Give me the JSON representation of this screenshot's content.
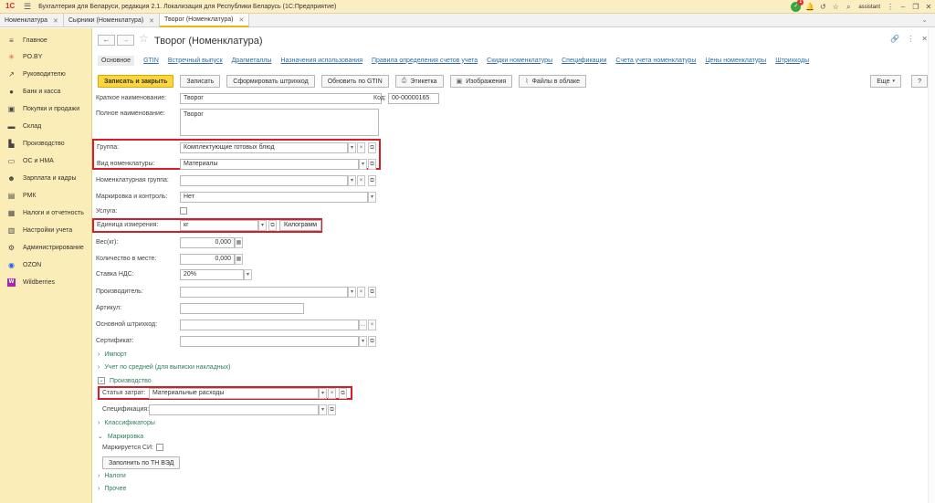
{
  "titlebar": {
    "logo": "1С",
    "title": "Бухгалтерия для Беларуси, редакция 2.1. Локализация для Республики Беларусь   (1С:Предприятие)",
    "notifications": "1",
    "user": "assistant"
  },
  "tabs": [
    {
      "label": "Номенклатура"
    },
    {
      "label": "Сырники (Номенклатура)"
    },
    {
      "label": "Творог (Номенклатура)"
    }
  ],
  "sidebar": {
    "items": [
      {
        "label": "Главное",
        "icon": "≡"
      },
      {
        "label": "PO.BY",
        "icon": "✳"
      },
      {
        "label": "Руководителю",
        "icon": "↗"
      },
      {
        "label": "Банк и касса",
        "icon": "●"
      },
      {
        "label": "Покупки и продажи",
        "icon": "▣"
      },
      {
        "label": "Склад",
        "icon": "▬"
      },
      {
        "label": "Производство",
        "icon": "▙"
      },
      {
        "label": "ОС и НМА",
        "icon": "▭"
      },
      {
        "label": "Зарплата и кадры",
        "icon": "☻"
      },
      {
        "label": "РМК",
        "icon": "▤"
      },
      {
        "label": "Налоги и отчетность",
        "icon": "▦"
      },
      {
        "label": "Настройки учета",
        "icon": "▥"
      },
      {
        "label": "Администрирование",
        "icon": "⚙"
      },
      {
        "label": "OZON",
        "icon": "◉"
      },
      {
        "label": "Wildberries",
        "icon": "W"
      }
    ]
  },
  "header": {
    "title": "Творог (Номенклатура)"
  },
  "sections": [
    {
      "label": "Основное"
    },
    {
      "label": "GTIN"
    },
    {
      "label": "Встречный выпуск"
    },
    {
      "label": "Драгметаллы"
    },
    {
      "label": "Назначения использования"
    },
    {
      "label": "Правила определения счетов учета"
    },
    {
      "label": "Скидки номенклатуры"
    },
    {
      "label": "Спецификации"
    },
    {
      "label": "Счета учета номенклатуры"
    },
    {
      "label": "Цены номенклатуры"
    },
    {
      "label": "Штрихкоды"
    }
  ],
  "toolbar": {
    "save_close": "Записать и закрыть",
    "save": "Записать",
    "barcode": "Сформировать штрихкод",
    "gtin": "Обновить по GTIN",
    "label": "Этикетка",
    "images": "Изображения",
    "files": "Файлы в облаке",
    "more": "Еще",
    "help": "?"
  },
  "form": {
    "short_name_label": "Краткое наименование:",
    "short_name": "Творог",
    "code_label": "Код:",
    "code": "00-00000165",
    "full_name_label": "Полное наименование:",
    "full_name": "Творог",
    "group_label": "Группа:",
    "group": "Комплектующие готовых блюд",
    "kind_label": "Вид номенклатуры:",
    "kind": "Материалы",
    "nom_group_label": "Номенклатурная группа:",
    "nom_group": "",
    "marking_label": "Маркировка и контроль:",
    "marking": "Нет",
    "service_label": "Услуга:",
    "unit_label": "Единица измерения:",
    "unit": "кг",
    "unit_full": "Килограмм",
    "weight_label": "Вес(кг):",
    "weight": "0,000",
    "qty_label": "Количество в месте:",
    "qty": "0,000",
    "vat_label": "Ставка НДС:",
    "vat": "20%",
    "producer_label": "Производитель:",
    "article_label": "Артикул:",
    "barcode_label": "Основной штрихкод:",
    "cert_label": "Сертификат:",
    "import_group": "Импорт",
    "avg_group": "Учет по средней (для выписки накладных)",
    "production_group": "Производство",
    "cost_label": "Статья затрат:",
    "cost": "Материальные расходы",
    "spec_label": "Спецификация:",
    "classifiers_group": "Классификаторы",
    "marking_group": "Маркировка",
    "marked_si_label": "Маркируется СИ:",
    "fill_btn": "Заполнить по ТН ВЭД",
    "taxes_group": "Налоги",
    "other_group": "Прочее"
  }
}
